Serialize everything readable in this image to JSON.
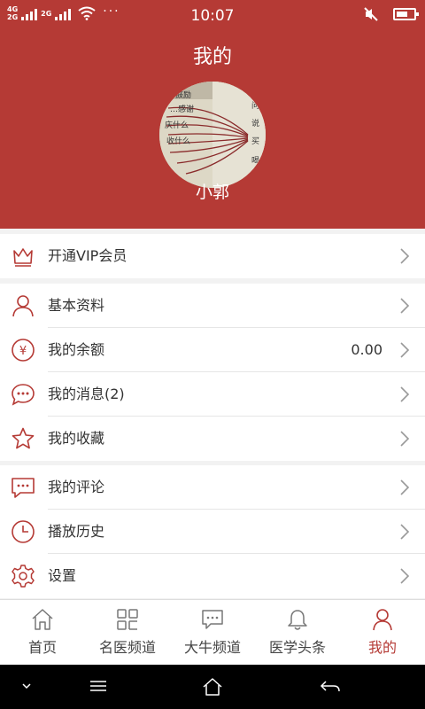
{
  "status_bar": {
    "time": "10:07",
    "network1": "4G",
    "network2": "2G",
    "network3": "2G",
    "dots": "···"
  },
  "header": {
    "title": "我的",
    "username": "小郭"
  },
  "avatar_text": [
    "鼓励",
    "…感谢",
    "庆什么",
    "收什么",
    "问",
    "说",
    "买",
    "喝"
  ],
  "menu": {
    "vip": {
      "label": "开通VIP会员",
      "icon": "crown-icon"
    },
    "profile": {
      "label": "基本资料",
      "icon": "person-icon"
    },
    "balance": {
      "label": "我的余额",
      "value": "0.00",
      "icon": "yen-icon"
    },
    "messages": {
      "label": "我的消息(2)",
      "icon": "chat-bubble-icon"
    },
    "favorites": {
      "label": "我的收藏",
      "icon": "star-icon"
    },
    "comments": {
      "label": "我的评论",
      "icon": "comment-icon"
    },
    "history": {
      "label": "播放历史",
      "icon": "clock-icon"
    },
    "settings": {
      "label": "设置",
      "icon": "gear-icon"
    }
  },
  "tabs": [
    {
      "label": "首页",
      "icon": "home-icon",
      "active": false
    },
    {
      "label": "名医频道",
      "icon": "grid-icon",
      "active": false
    },
    {
      "label": "大牛频道",
      "icon": "chat-dots-icon",
      "active": false
    },
    {
      "label": "医学头条",
      "icon": "bell-icon",
      "active": false
    },
    {
      "label": "我的",
      "icon": "user-icon",
      "active": true
    }
  ],
  "colors": {
    "brand": "#b53a35",
    "icon_red": "#c0392b",
    "text": "#333333"
  }
}
